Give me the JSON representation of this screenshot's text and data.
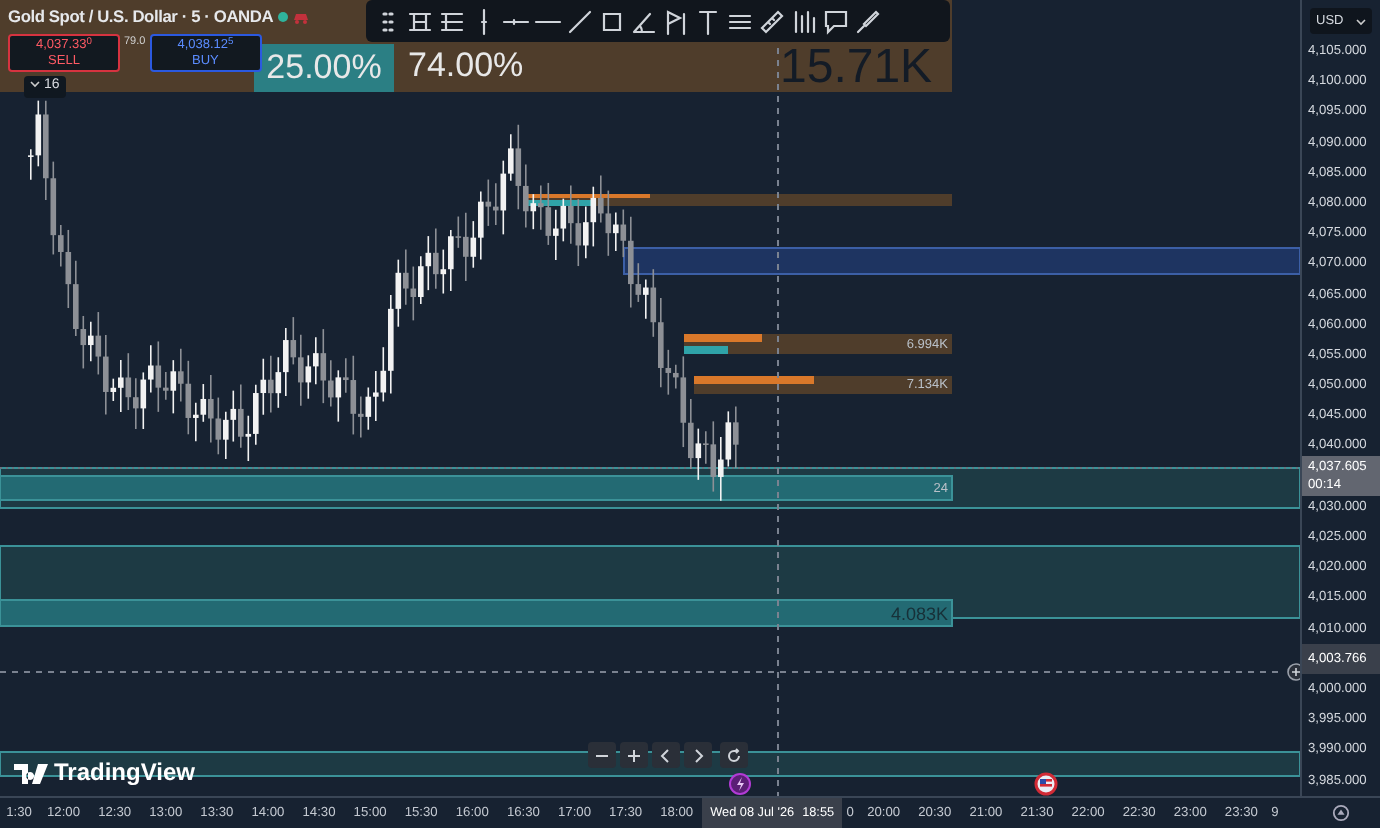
{
  "legend": {
    "symbol": "Gold Spot / U.S. Dollar · 5 · OANDA",
    "sell_price": "4,037.33$^{0}$",
    "sell_label": "SELL",
    "spread": "79.0",
    "buy_price": "4,038.12$^{5}$",
    "buy_label": "BUY",
    "indicators_count": "16"
  },
  "position_tool": {
    "stop_percent": "25.00%",
    "target_percent": "74.00%",
    "amount": "15.71K"
  },
  "zones": [
    {
      "kind": "brown"
    },
    {
      "kind": "blue"
    },
    {
      "kind": "brown",
      "label": "6.994K"
    },
    {
      "kind": "brown",
      "label": "7.134K"
    },
    {
      "kind": "teal",
      "label": "24"
    },
    {
      "kind": "teal",
      "label": "4.083K"
    }
  ],
  "price_axis": {
    "currency": "USD",
    "labels": [
      {
        "kind": "tick",
        "text": "4,105.000"
      },
      {
        "kind": "tick",
        "text": "4,100.000"
      },
      {
        "kind": "tick",
        "text": "4,095.000"
      },
      {
        "kind": "tick",
        "text": "4,090.000"
      },
      {
        "kind": "tick",
        "text": "4,085.000"
      },
      {
        "kind": "tick",
        "text": "4,080.000"
      },
      {
        "kind": "tick",
        "text": "4,075.000"
      },
      {
        "kind": "tick",
        "text": "4,070.000"
      },
      {
        "kind": "tick",
        "text": "4,065.000"
      },
      {
        "kind": "tick",
        "text": "4,060.000"
      },
      {
        "kind": "tick",
        "text": "4,055.000"
      },
      {
        "kind": "tick",
        "text": "4,050.000"
      },
      {
        "kind": "tick",
        "text": "4,045.000"
      },
      {
        "kind": "tick",
        "text": "4,040.000"
      },
      {
        "kind": "last_price",
        "text": "4,037.605",
        "countdown": "00:14"
      },
      {
        "kind": "tick",
        "text": "4,030.000"
      },
      {
        "kind": "tick",
        "text": "4,025.000"
      },
      {
        "kind": "tick",
        "text": "4,020.000"
      },
      {
        "kind": "tick",
        "text": "4,015.000"
      },
      {
        "kind": "tick",
        "text": "4,010.000"
      },
      {
        "kind": "crosshair",
        "text": "4,003.766"
      },
      {
        "kind": "tick",
        "text": "4,000.000"
      },
      {
        "kind": "tick",
        "text": "3,995.000"
      },
      {
        "kind": "tick",
        "text": "3,990.000"
      },
      {
        "kind": "tick",
        "text": "3,985.000"
      }
    ]
  },
  "time_axis": {
    "labels": [
      {
        "kind": "tick",
        "text": "1:30"
      },
      {
        "kind": "tick",
        "text": "12:00"
      },
      {
        "kind": "tick",
        "text": "12:30"
      },
      {
        "kind": "tick",
        "text": "13:00"
      },
      {
        "kind": "tick",
        "text": "13:30"
      },
      {
        "kind": "tick",
        "text": "14:00"
      },
      {
        "kind": "tick",
        "text": "14:30"
      },
      {
        "kind": "tick",
        "text": "15:00"
      },
      {
        "kind": "tick",
        "text": "15:30"
      },
      {
        "kind": "tick",
        "text": "16:00"
      },
      {
        "kind": "tick",
        "text": "16:30"
      },
      {
        "kind": "tick",
        "text": "17:00"
      },
      {
        "kind": "tick",
        "text": "17:30"
      },
      {
        "kind": "tick",
        "text": "18:00"
      },
      {
        "kind": "crosshair",
        "text": "Wed 08 Jul '26",
        "clock": "18:55"
      },
      {
        "kind": "tick",
        "text": "0"
      },
      {
        "kind": "tick",
        "text": "20:00"
      },
      {
        "kind": "tick",
        "text": "20:30"
      },
      {
        "kind": "tick",
        "text": "21:00"
      },
      {
        "kind": "tick",
        "text": "21:30"
      },
      {
        "kind": "tick",
        "text": "22:00"
      },
      {
        "kind": "tick",
        "text": "22:30"
      },
      {
        "kind": "tick",
        "text": "23:00"
      },
      {
        "kind": "tick",
        "text": "23:30"
      },
      {
        "kind": "tick",
        "text": "9"
      }
    ]
  },
  "logo": {
    "text": "TradingView"
  }
}
